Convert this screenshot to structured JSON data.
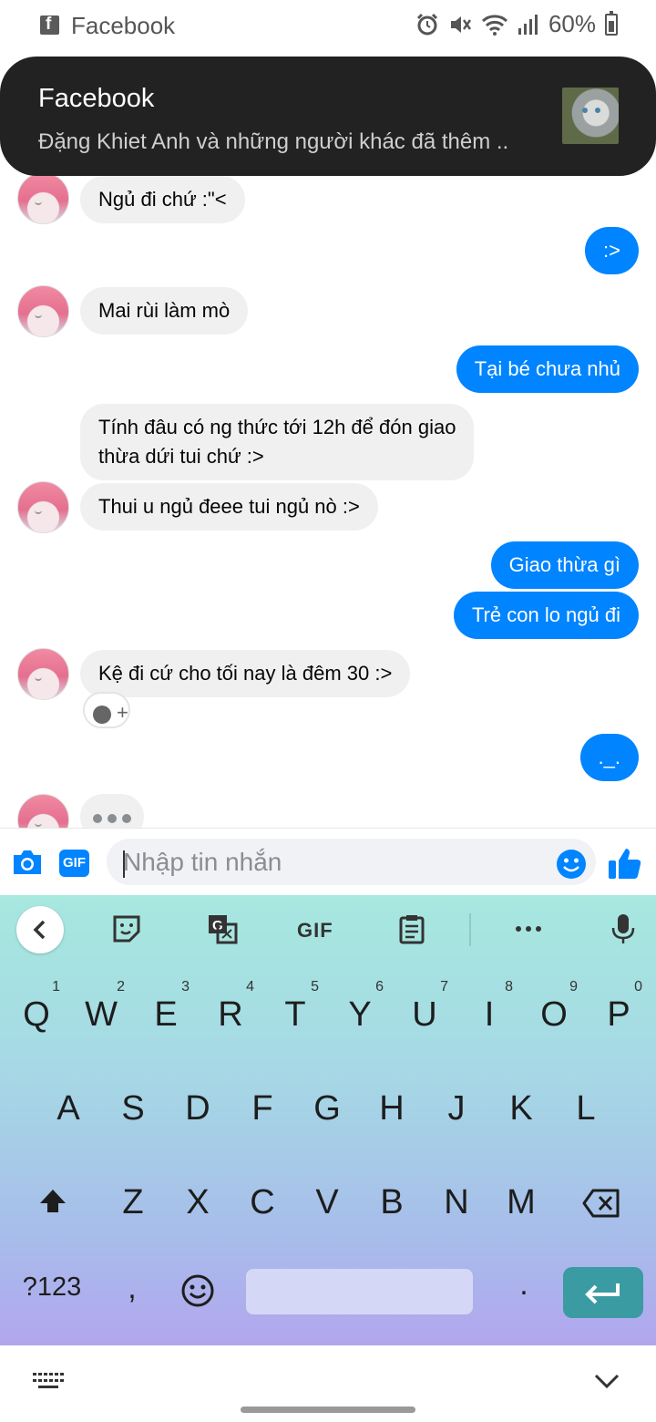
{
  "status_bar": {
    "app_name": "Facebook",
    "battery": "60%",
    "icons": [
      "facebook-icon",
      "alarm-icon",
      "mute-icon",
      "wifi-icon",
      "signal-icon",
      "battery-icon"
    ]
  },
  "notification": {
    "title": "Facebook",
    "text": "Đặng Khiet Anh và những người khác đã thêm ..",
    "thumbnail": "cat-photo"
  },
  "messages": [
    {
      "side": "in",
      "text": "Ngủ đi chứ :\"<",
      "avatar": true
    },
    {
      "side": "out",
      "text": ":>"
    },
    {
      "side": "in",
      "text": "Mai rùi làm mò",
      "avatar": true
    },
    {
      "side": "out",
      "text": "Tại bé chưa nhủ"
    },
    {
      "side": "in",
      "text": "Tính đâu có ng thức tới 12h để đón giao",
      "text2": "thừa dứi tui chứ :>"
    },
    {
      "side": "in",
      "text": "Thui u ngủ đeee tui ngủ nò :>",
      "avatar": true
    },
    {
      "side": "out",
      "text": "Giao thừa gì"
    },
    {
      "side": "out",
      "text": "Trẻ con lo ngủ đi"
    },
    {
      "side": "in",
      "text": "Kệ đi cứ cho tối nay là đêm 30 :>",
      "avatar": true,
      "reaction": "add-reaction"
    },
    {
      "side": "out",
      "text": "._."
    },
    {
      "side": "in",
      "typing": true,
      "avatar": true
    }
  ],
  "composer": {
    "placeholder": "Nhập tin nhắn",
    "gif_label": "GIF"
  },
  "keyboard": {
    "gif_label": "GIF",
    "row1": [
      {
        "k": "Q",
        "n": "1"
      },
      {
        "k": "W",
        "n": "2"
      },
      {
        "k": "E",
        "n": "3"
      },
      {
        "k": "R",
        "n": "4"
      },
      {
        "k": "T",
        "n": "5"
      },
      {
        "k": "Y",
        "n": "6"
      },
      {
        "k": "U",
        "n": "7"
      },
      {
        "k": "I",
        "n": "8"
      },
      {
        "k": "O",
        "n": "9"
      },
      {
        "k": "P",
        "n": "0"
      }
    ],
    "row2": [
      "A",
      "S",
      "D",
      "F",
      "G",
      "H",
      "J",
      "K",
      "L"
    ],
    "row3": [
      "Z",
      "X",
      "C",
      "V",
      "B",
      "N",
      "M"
    ],
    "symbols_label": "?123",
    "comma": ",",
    "period": "."
  },
  "colors": {
    "messenger_blue": "#0084ff",
    "incoming_bubble": "#f0f0f0",
    "notification_bg": "#222222",
    "enter_key": "#3a9ba2"
  }
}
